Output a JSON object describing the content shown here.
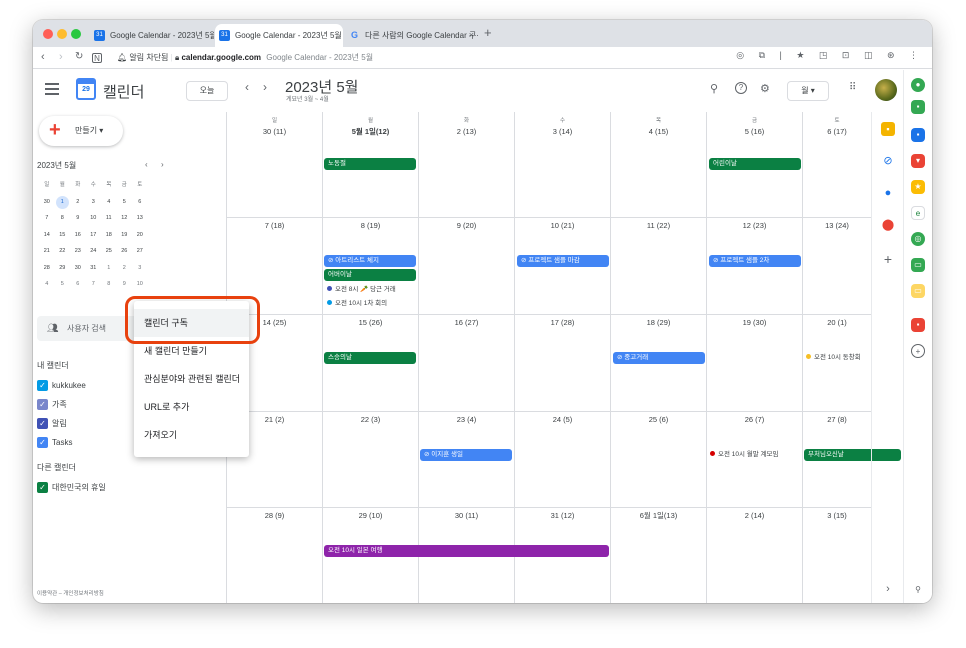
{
  "browser": {
    "tabs": [
      {
        "title": "Google Calendar - 2023년 5월",
        "active": false
      },
      {
        "title": "Google Calendar - 2023년 5월",
        "active": true
      },
      {
        "title": "다른 사람의 Google Calendar 구·",
        "active": false
      }
    ],
    "new_tab": "+",
    "security_label": "알림 차단됨",
    "url_host": "calendar.google.com",
    "url_title": "Google Calendar - 2023년 5월"
  },
  "header": {
    "app_name": "캘린더",
    "logo_num": "29",
    "today_btn": "오늘",
    "month_title": "2023년 5월",
    "week_range": "계묘년 3월 ~ 4월",
    "view_btn": "월 ▾"
  },
  "sidebar": {
    "create_label": "만들기 ▾",
    "mini_title": "2023년 5월",
    "mini_days": [
      "일",
      "월",
      "화",
      "수",
      "목",
      "금",
      "토"
    ],
    "mini_weeks": [
      [
        "30",
        "1",
        "2",
        "3",
        "4",
        "5",
        "6"
      ],
      [
        "7",
        "8",
        "9",
        "10",
        "11",
        "12",
        "13"
      ],
      [
        "14",
        "15",
        "16",
        "17",
        "18",
        "19",
        "20"
      ],
      [
        "21",
        "22",
        "23",
        "24",
        "25",
        "26",
        "27"
      ],
      [
        "28",
        "29",
        "30",
        "31",
        "1",
        "2",
        "3"
      ],
      [
        "4",
        "5",
        "6",
        "7",
        "8",
        "9",
        "10"
      ]
    ],
    "user_search": "사용자 검색",
    "my_cals_title": "내 캘린더",
    "my_cals": [
      {
        "name": "kukkukee",
        "color": "#039be5"
      },
      {
        "name": "가족",
        "color": "#7986cb"
      },
      {
        "name": "알림",
        "color": "#3f51b5"
      },
      {
        "name": "Tasks",
        "color": "#4285f4"
      }
    ],
    "other_cals_title": "다른 캘린더",
    "other_cals": [
      {
        "name": "대한민국의 휴일",
        "color": "#0b8043"
      }
    ],
    "footer": "이용약관 – 개인정보처리방침"
  },
  "grid": {
    "dows": [
      "일",
      "월",
      "화",
      "수",
      "목",
      "금",
      "토"
    ],
    "weeks": [
      [
        "30 (11)",
        "5월 1일(12)",
        "2 (13)",
        "3 (14)",
        "4 (15)",
        "5 (16)",
        "6 (17)"
      ],
      [
        "7 (18)",
        "8 (19)",
        "9 (20)",
        "10 (21)",
        "11 (22)",
        "12 (23)",
        "13 (24)"
      ],
      [
        "14 (25)",
        "15 (26)",
        "16 (27)",
        "17 (28)",
        "18 (29)",
        "19 (30)",
        "20 (1)"
      ],
      [
        "21 (2)",
        "22 (3)",
        "23 (4)",
        "24 (5)",
        "25 (6)",
        "26 (7)",
        "27 (8)"
      ],
      [
        "28 (9)",
        "29 (10)",
        "30 (11)",
        "31 (12)",
        "6월 1일(13)",
        "2 (14)",
        "3 (15)"
      ]
    ],
    "events": {
      "labor_day": "노동절",
      "childrens_day": "어린이날",
      "artist_check": "⊘ 아트리스트 체지",
      "parents_day": "어버이날",
      "carrot": "오전 8시 🥕 당근 거래",
      "first_meeting": "오전 10시 1차 회의",
      "proj_sample": "⊘ 프로젝트 샘플 마감",
      "proj_sample2": "⊘ 프로젝트 샘플 2차",
      "teachers_day": "스승의날",
      "used_trade": "⊘ 중고거래",
      "reunion": "오전 10시 동창회",
      "birthday": "⊘ 이지훈 생일",
      "monthly": "오전 10시 월말 계모임",
      "buddha": "부처님오신날",
      "japan_trip": "오전 10시 일본 여행"
    }
  },
  "dropdown": {
    "items": [
      "캘린더 구독",
      "새 캘린더 만들기",
      "관심분야와 관련된 캘린더",
      "URL로 추가",
      "가져오기"
    ]
  },
  "colors": {
    "green_event": "#0b8043",
    "blue_event": "#4285f4",
    "purple_event": "#8e24aa",
    "highlight": "#e8410e"
  }
}
